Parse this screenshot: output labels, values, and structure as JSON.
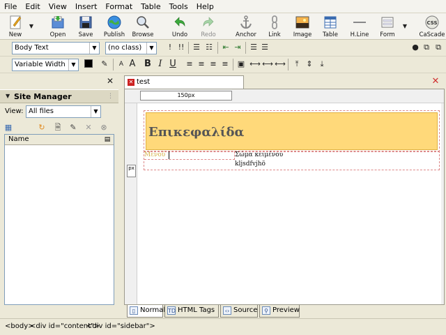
{
  "menu": [
    "File",
    "Edit",
    "View",
    "Insert",
    "Format",
    "Table",
    "Tools",
    "Help"
  ],
  "toolbar": {
    "new": "New",
    "open": "Open",
    "save": "Save",
    "publish": "Publish",
    "browse": "Browse",
    "undo": "Undo",
    "redo": "Redo",
    "anchor": "Anchor",
    "link": "Link",
    "image": "Image",
    "table": "Table",
    "hline": "H.Line",
    "form": "Form",
    "css": "CaScade"
  },
  "format": {
    "paragraph_style": "Body Text",
    "class_select": "(no class)",
    "font_select": "Variable Width"
  },
  "site_manager": {
    "title": "Site Manager",
    "view_label": "View:",
    "view_value": "All files",
    "column_name": "Name"
  },
  "document": {
    "tab_title": "test",
    "ruler_label": "150px",
    "vertical_marker": "px",
    "heading": "Επικεφαλίδα",
    "menu_text": "Μενού",
    "body_line1": "Σώμα κειμένου",
    "body_line2": "kljsdfvjhö"
  },
  "mode_tabs": {
    "normal": "Normal",
    "html_tags": "HTML Tags",
    "source": "Source",
    "preview": "Preview"
  },
  "status": {
    "tag1": "<body>",
    "tag2": "<div id=\"content\">",
    "tag3": "<div id=\"sidebar\">"
  },
  "colors": {
    "heading_bg": "#ffd97a",
    "menu_text": "#d4b14a",
    "close_red": "#d03030"
  }
}
